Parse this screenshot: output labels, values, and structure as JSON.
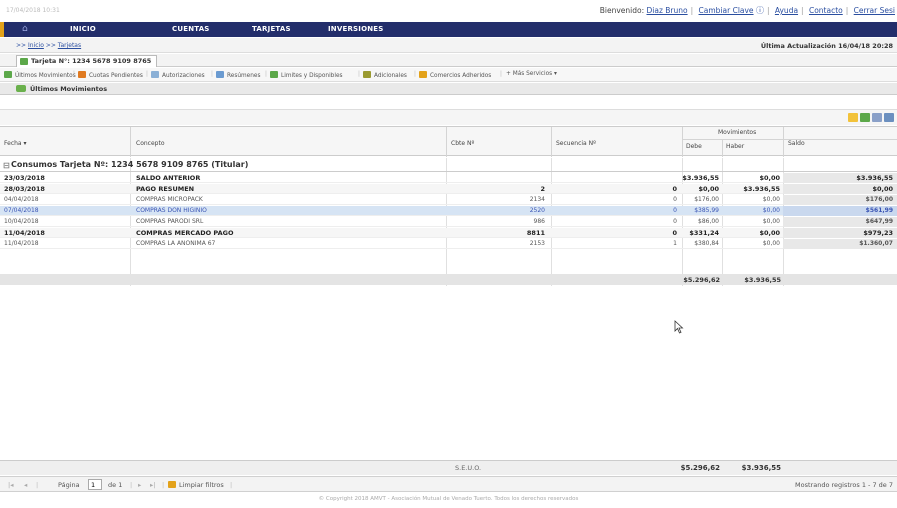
{
  "topbar": {
    "datetime": "17/04/2018 10:31",
    "welcome_prefix": "Bienvenido:",
    "user": "Diaz Bruno",
    "change_key": "Cambiar Clave",
    "help": "Ayuda",
    "contact": "Contacto",
    "logout": "Cerrar Sesi"
  },
  "nav": {
    "items": [
      "INICIO",
      "CUENTAS",
      "TARJETAS",
      "INVERSIONES"
    ]
  },
  "breadcrumb": {
    "prefix": ">>",
    "home": "Inicio",
    "mid": ">>",
    "current": "Tarjetas"
  },
  "last_update": "Última Actualización 16/04/18 20:28",
  "tab": {
    "label": "Tarjeta N°: 1234 5678 9109 8765"
  },
  "toolbar": {
    "items": [
      "Últimos Movimientos",
      "Cuotas Pendientes",
      "Autorizaciones",
      "Resúmenes",
      "Limites y Disponibles",
      "Adicionales",
      "Comercios Adheridos",
      "Más Servicios"
    ],
    "colors": [
      "#5ca84a",
      "#e07a20",
      "#8bb0d6",
      "#6b9bd1",
      "#5ca84a",
      "#9a9a30",
      "#e3a21a",
      "#888888"
    ],
    "more_prefix": "+",
    "more_suffix": "▾"
  },
  "section": {
    "title": "Últimos Movimientos"
  },
  "table": {
    "headers": {
      "fecha": "Fecha",
      "fecha_sort": "▾",
      "concepto": "Concepto",
      "cbte": "Cbte Nº",
      "secuencia": "Secuencia Nº",
      "movimientos": "Movimientos",
      "debe": "Debe",
      "haber": "Haber",
      "saldo": "Saldo"
    },
    "group_toggle": "⊟",
    "group": "Consumos Tarjeta Nº: 1234 5678 9109 8765 (Titular)",
    "rows": [
      {
        "fecha": "23/03/2018",
        "concepto": "SALDO ANTERIOR",
        "cbte": "",
        "sec": "",
        "debe": "$3.936,55",
        "haber": "$0,00",
        "saldo": "$3.936,55",
        "bold": true
      },
      {
        "fecha": "28/03/2018",
        "concepto": "PAGO RESUMEN",
        "cbte": "2",
        "sec": "0",
        "debe": "$0,00",
        "haber": "$3.936,55",
        "saldo": "$0,00",
        "bold": true
      },
      {
        "fecha": "04/04/2018",
        "concepto": "COMPRAS MICROPACK",
        "cbte": "2134",
        "sec": "0",
        "debe": "$176,00",
        "haber": "$0,00",
        "saldo": "$176,00",
        "bold": false
      },
      {
        "fecha": "07/04/2018",
        "concepto": "COMPRAS DON HIGINIO",
        "cbte": "2520",
        "sec": "0",
        "debe": "$385,99",
        "haber": "$0,00",
        "saldo": "$561,99",
        "bold": false,
        "selected": true
      },
      {
        "fecha": "10/04/2018",
        "concepto": "COMPRAS PARODI SRL",
        "cbte": "986",
        "sec": "0",
        "debe": "$86,00",
        "haber": "$0,00",
        "saldo": "$647,99",
        "bold": false
      },
      {
        "fecha": "11/04/2018",
        "concepto": "COMPRAS MERCADO PAGO",
        "cbte": "8811",
        "sec": "0",
        "debe": "$331,24",
        "haber": "$0,00",
        "saldo": "$979,23",
        "bold": true
      },
      {
        "fecha": "11/04/2018",
        "concepto": "COMPRAS LA ANONIMA 67",
        "cbte": "2153",
        "sec": "1",
        "debe": "$380,84",
        "haber": "$0,00",
        "saldo": "$1.360,07",
        "bold": false
      }
    ],
    "subtotal": {
      "debe": "$5.296,62",
      "haber": "$3.936,55"
    }
  },
  "footer_totals": {
    "debe": "$5.296,62",
    "haber": "$3.936,55",
    "center": "S.E.U.O."
  },
  "pager": {
    "first": "|◂",
    "prev": "◂",
    "page_label": "Página",
    "page_value": "1",
    "of_label": "de 1",
    "next": "▸",
    "last": "▸|",
    "clear_filters": "Limpiar filtros",
    "showing": "Mostrando registros 1 - 7 de 7"
  },
  "copyright": "© Copyright 2018 AMVT - Asociación Mutual de Venado Tuerto. Todos los derechos reservados"
}
